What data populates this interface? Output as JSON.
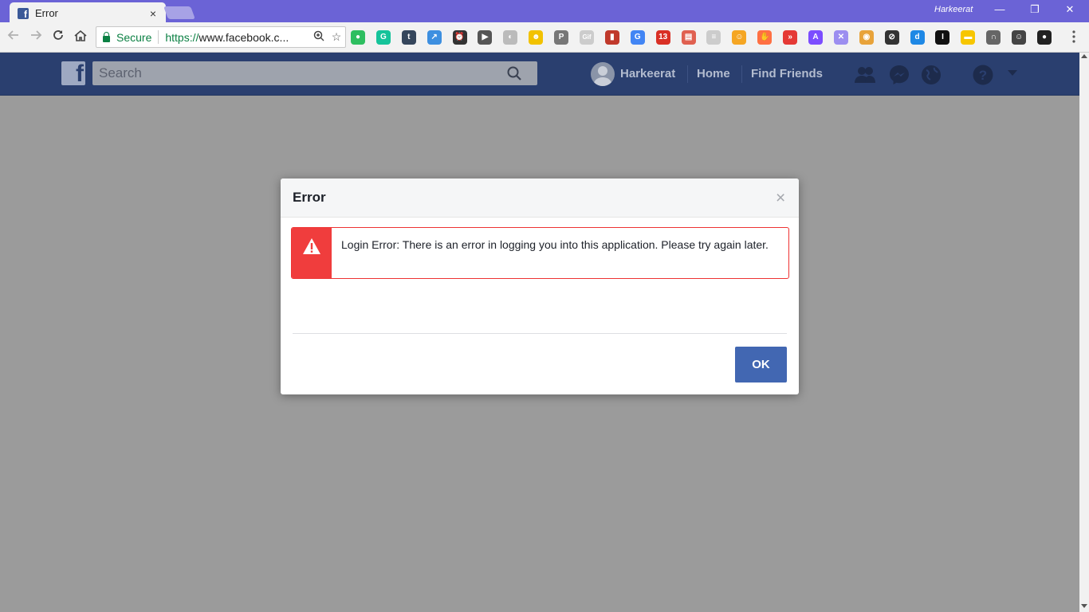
{
  "browser": {
    "tab_title": "Error",
    "tab_favicon_letter": "f",
    "tab_close": "×",
    "profile_name": "Harkeerat",
    "minimize": "—",
    "restore": "❐",
    "close": "✕",
    "secure_label": "Secure",
    "url_scheme": "https://",
    "url_host": "www.facebook.c...",
    "extensions": [
      {
        "name": "evernote-icon",
        "color": "#2dbe60",
        "glyph": "●"
      },
      {
        "name": "grammarly-icon",
        "color": "#15c39a",
        "glyph": "G"
      },
      {
        "name": "tumblr-icon",
        "color": "#35465c",
        "glyph": "t"
      },
      {
        "name": "share-icon",
        "color": "#3d8fe0",
        "glyph": "↗"
      },
      {
        "name": "alarm-icon",
        "color": "#333333",
        "glyph": "⏰"
      },
      {
        "name": "youtube-icon",
        "color": "#555555",
        "glyph": "▶"
      },
      {
        "name": "disabled-ext-icon",
        "color": "#bbbbbb",
        "glyph": "◐"
      },
      {
        "name": "smile-ext-icon",
        "color": "#f2c200",
        "glyph": "☻"
      },
      {
        "name": "pinterest-icon",
        "color": "#777777",
        "glyph": "P"
      },
      {
        "name": "gif-icon",
        "color": "#cccccc",
        "glyph": "Gif"
      },
      {
        "name": "book-icon",
        "color": "#c0392b",
        "glyph": "▮"
      },
      {
        "name": "translate-icon",
        "color": "#4285f4",
        "glyph": "G"
      },
      {
        "name": "mail-badge-icon",
        "color": "#d93025",
        "glyph": "13"
      },
      {
        "name": "calendar-ext-icon",
        "color": "#e06050",
        "glyph": "▤"
      },
      {
        "name": "reader-icon",
        "color": "#cccccc",
        "glyph": "≡"
      },
      {
        "name": "emoji-icon",
        "color": "#f5a623",
        "glyph": "☺"
      },
      {
        "name": "hand-icon",
        "color": "#ff7043",
        "glyph": "✋"
      },
      {
        "name": "red-arrow-icon",
        "color": "#e53935",
        "glyph": "»"
      },
      {
        "name": "vpn-icon",
        "color": "#7c4dff",
        "glyph": "A"
      },
      {
        "name": "cross-ext-icon",
        "color": "#9c8ef0",
        "glyph": "✕"
      },
      {
        "name": "chrome-ext-icon",
        "color": "#e8a33a",
        "glyph": "◉"
      },
      {
        "name": "block-icon",
        "color": "#333333",
        "glyph": "⊘"
      },
      {
        "name": "new-ext-icon",
        "color": "#1e88e5",
        "glyph": "d"
      },
      {
        "name": "instapaper-icon",
        "color": "#111111",
        "glyph": "I"
      },
      {
        "name": "sticky-note-icon",
        "color": "#f7c600",
        "glyph": "▬"
      },
      {
        "name": "arch-icon",
        "color": "#666666",
        "glyph": "∩"
      },
      {
        "name": "raccoon-icon",
        "color": "#444444",
        "glyph": "☺"
      },
      {
        "name": "circle-ext-icon",
        "color": "#222222",
        "glyph": "●"
      }
    ],
    "menu": "⋮"
  },
  "fb": {
    "logo_letter": "f",
    "search_placeholder": "Search",
    "user_name": "Harkeerat",
    "home_label": "Home",
    "find_friends_label": "Find Friends"
  },
  "dialog": {
    "title": "Error",
    "close": "×",
    "message": "Login Error: There is an error in logging you into this application. Please try again later.",
    "ok_label": "OK"
  },
  "colors": {
    "fb_blue": "#4267b2",
    "error_red": "#f03d3d",
    "chrome_titlebar": "#6b63d6"
  }
}
